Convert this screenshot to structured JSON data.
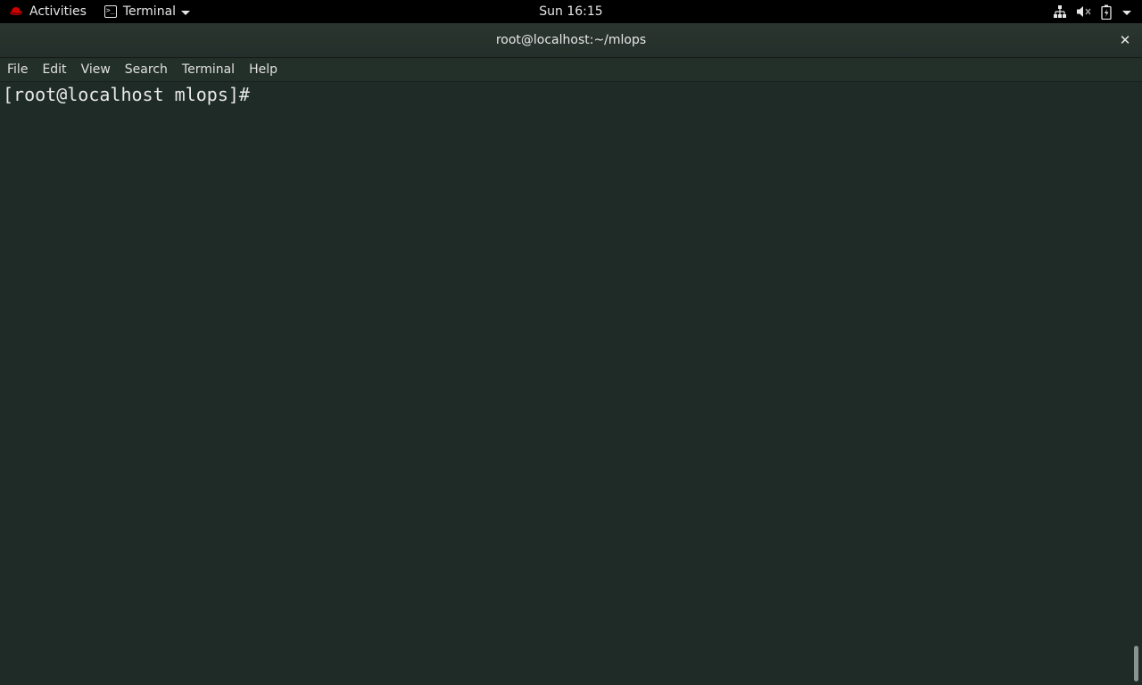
{
  "topbar": {
    "activities_label": "Activities",
    "app_menu_label": "Terminal",
    "clock": "Sun 16:15",
    "tray_icons": [
      "network-icon",
      "volume-muted-icon",
      "battery-icon",
      "system-menu-caret-icon"
    ]
  },
  "window": {
    "title": "root@localhost:~/mlops",
    "close_glyph": "✕"
  },
  "menubar": {
    "items": [
      "File",
      "Edit",
      "View",
      "Search",
      "Terminal",
      "Help"
    ]
  },
  "terminal": {
    "prompt": "[root@localhost mlops]#"
  },
  "colors": {
    "topbar_bg": "#000000",
    "window_bg": "#1f2b27",
    "redhat_red": "#cc0000"
  }
}
